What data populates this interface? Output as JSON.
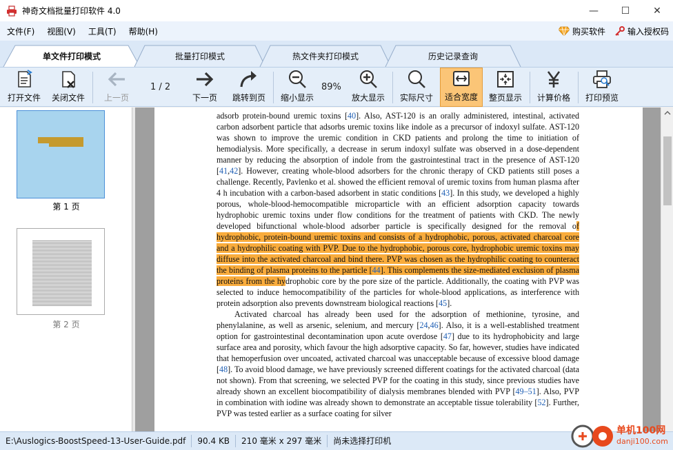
{
  "window": {
    "title": "神奇文档批量打印软件 4.0",
    "controls": {
      "minimize": "—",
      "maximize": "☐",
      "close": "✕"
    }
  },
  "menu": {
    "items": [
      "文件(F)",
      "视图(V)",
      "工具(T)",
      "帮助(H)"
    ],
    "buy": "购买软件",
    "license": "输入授权码"
  },
  "tabs": [
    "单文件打印模式",
    "批量打印模式",
    "热文件夹打印模式",
    "历史记录查询"
  ],
  "toolbar": {
    "open": "打开文件",
    "close": "关闭文件",
    "prev": "上一页",
    "page_indicator": "1 / 2",
    "next": "下一页",
    "goto": "跳转到页",
    "zoom_out": "缩小显示",
    "zoom_level": "89%",
    "zoom_in": "放大显示",
    "actual_size": "实际尺寸",
    "fit_width": "适合宽度",
    "fit_page": "整页显示",
    "calc_price": "计算价格",
    "print_preview": "打印预览"
  },
  "thumbnails": [
    "第 1 页",
    "第 2 页"
  ],
  "document": {
    "p1": [
      {
        "t": "adsorb protein-bound uremic toxins ["
      },
      {
        "t": "40",
        "ref": true
      },
      {
        "t": "]. Also, AST-120 is an orally administered, intestinal, activated carbon adsorbent particle that adsorbs uremic toxins like indole as a precursor of indoxyl sulfate. AST-120 was shown to improve the uremic condition in CKD patients and prolong the time to initiation of hemodialysis. More specifically, a decrease in serum indoxyl sulfate was observed in a dose-dependent manner by reducing the absorption of indole from the gastrointestinal tract in the presence of AST-120 ["
      },
      {
        "t": "41",
        "ref": true
      },
      {
        "t": ","
      },
      {
        "t": "42",
        "ref": true
      },
      {
        "t": "]. However, creating whole-blood adsorbers for the chronic therapy of CKD patients still poses a challenge. Recently, Pavlenko et al. showed the efficient removal of uremic toxins from human plasma after 4 h incubation with a carbon-based adsorbent in static conditions ["
      },
      {
        "t": "43",
        "ref": true
      },
      {
        "t": "]. In this study, we developed a highly porous, whole-blood-hemocompatible microparticle with an efficient adsorption capacity towards hydrophobic uremic toxins under flow conditions for the treatment of patients with CKD. The newly developed bifunctional whole-blood adsorber particle is specifically designed for the removal o"
      },
      {
        "t": "f hydrophobic, protein-bound uremic toxins and consists of a hydrophobic, porous, activated charcoal core and a hydrophilic coating with PVP. Due to the hydrophobic, porous core, hydrophobic uremic toxins may diffuse into the activated charcoal and bind there.  PVP was chosen as the hydrophilic coating to counteract the binding of plasma proteins to the particle [",
        "hl": true
      },
      {
        "t": "44",
        "hl": true,
        "ref": true
      },
      {
        "t": "]. This complements the size-mediated exclusion of plasma proteins from the hy",
        "hl": true
      },
      {
        "t": "drophobic core by the pore size of the particle. Additionally, the coating with PVP was selected to induce hemocompatibility of the particles for whole-blood applications, as interference with protein adsorption also prevents downstream biological reactions ["
      },
      {
        "t": "45",
        "ref": true
      },
      {
        "t": "]."
      }
    ],
    "p2": [
      {
        "t": "Activated charcoal has already been used for the adsorption of methionine, tyrosine, and phenylalanine, as well as arsenic, selenium, and mercury ["
      },
      {
        "t": "24",
        "ref": true
      },
      {
        "t": ","
      },
      {
        "t": "46",
        "ref": true
      },
      {
        "t": "]. Also, it is a well-established treatment option for gastrointestinal decontamination upon acute overdose ["
      },
      {
        "t": "47",
        "ref": true
      },
      {
        "t": "] due to its hydrophobicity and large surface area and porosity, which favour the high adsorptive capacity. So far, however, studies have indicated that hemoperfusion over uncoated, activated charcoal was unacceptable because of excessive blood damage ["
      },
      {
        "t": "48",
        "ref": true
      },
      {
        "t": "]. To avoid blood damage, we have previously screened different coatings for the activated charcoal (data not shown). From that screening, we selected PVP for the coating in this study, since previous studies have already shown an excellent biocompatibility of dialysis membranes blended with PVP ["
      },
      {
        "t": "49–51",
        "ref": true
      },
      {
        "t": "]. Also, PVP in combination with iodine was already shown to demonstrate an acceptable tissue tolerability ["
      },
      {
        "t": "52",
        "ref": true
      },
      {
        "t": "]. Further, PVP was tested earlier as a surface coating for silver"
      }
    ]
  },
  "status": {
    "file": "E:\\Auslogics-BoostSpeed-13-User-Guide.pdf",
    "size": "90.4 KB",
    "dimensions": "210 毫米 x 297 毫米",
    "printer": "尚未选择打印机"
  },
  "watermark": {
    "site_cn": "单机100网",
    "site_url": "danji100.com"
  },
  "colors": {
    "active_tab": "#ffffff",
    "highlight": "#f9ac3c",
    "active_tool": "#fbc577",
    "link": "#1f5fb4"
  }
}
